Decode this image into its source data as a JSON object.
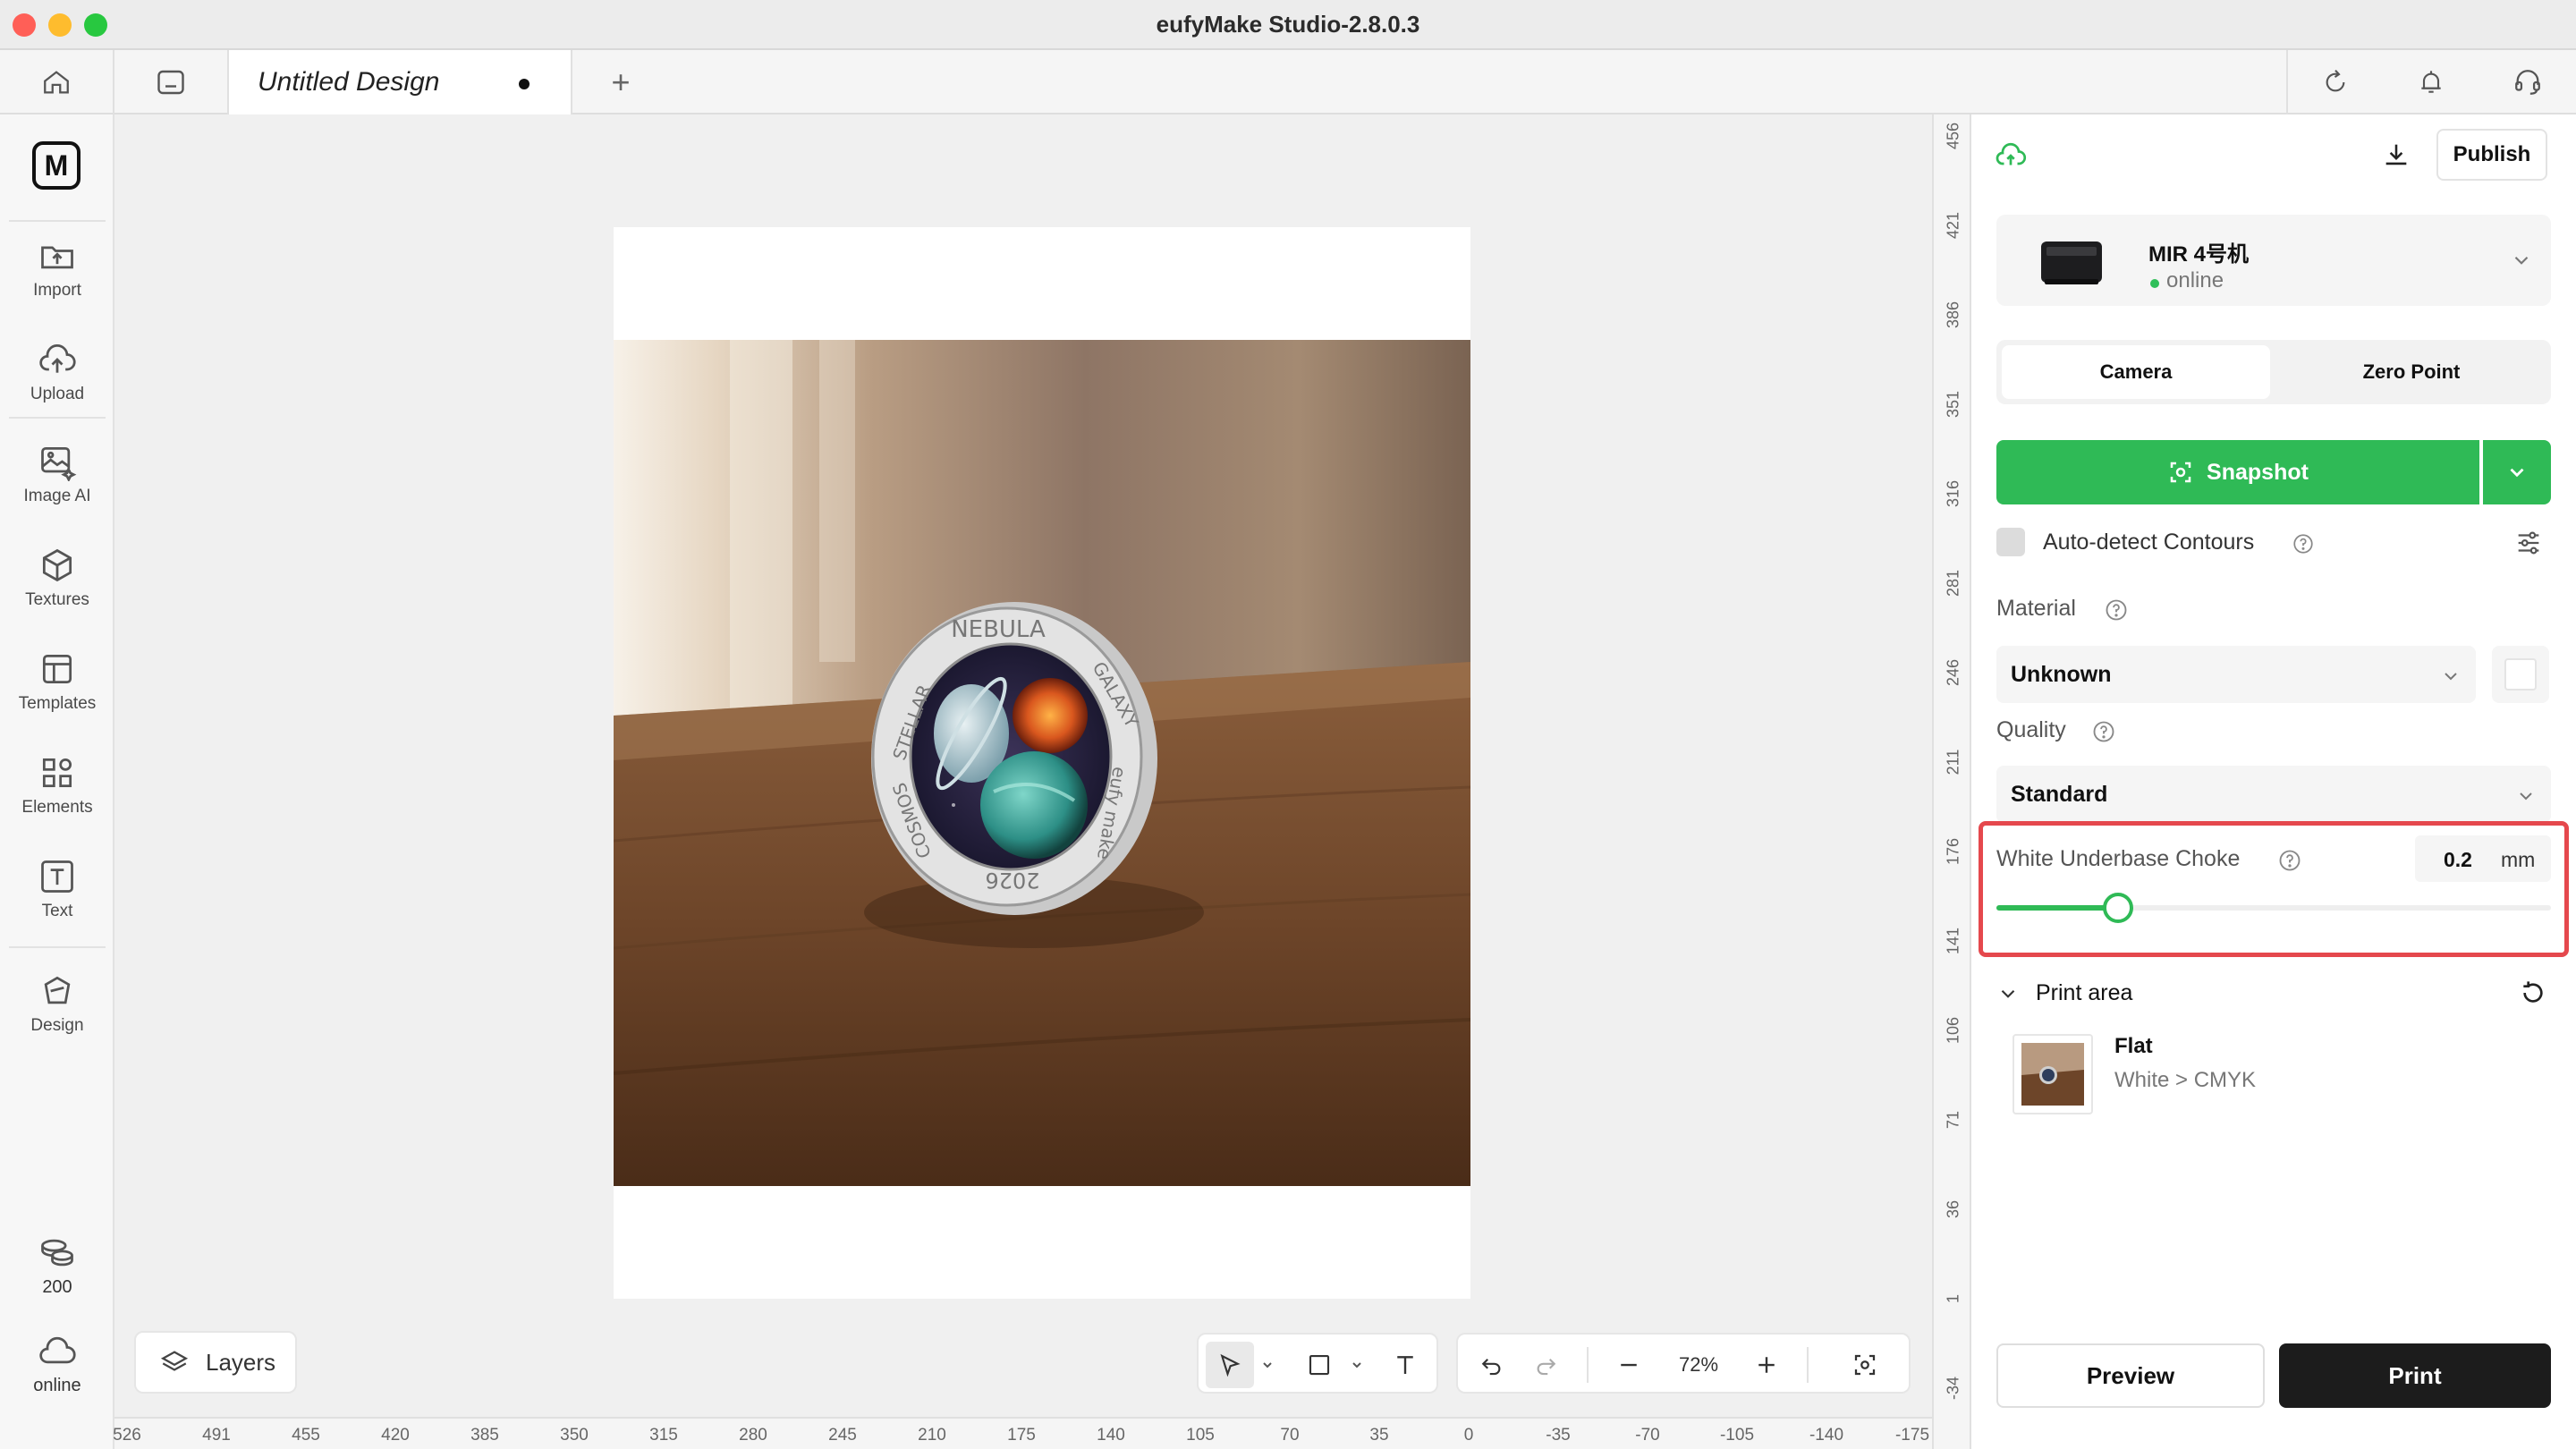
{
  "window": {
    "title": "eufyMake Studio-2.8.0.3"
  },
  "tabs": {
    "document_name": "Untitled Design",
    "add_tab_label": "+"
  },
  "sidebar": {
    "logo": "M",
    "items": [
      {
        "label": "Import",
        "icon": "import-icon"
      },
      {
        "label": "Upload",
        "icon": "upload-icon"
      },
      {
        "label": "Image AI",
        "icon": "image-ai-icon"
      },
      {
        "label": "Textures",
        "icon": "textures-icon"
      },
      {
        "label": "Templates",
        "icon": "templates-icon"
      },
      {
        "label": "Elements",
        "icon": "elements-icon"
      },
      {
        "label": "Text",
        "icon": "text-icon"
      },
      {
        "label": "Design",
        "icon": "design-icon"
      }
    ],
    "credits": "200",
    "status": "online"
  },
  "canvas": {
    "layers_label": "Layers",
    "zoom": "72%",
    "coin_text": {
      "top": "NEBULA",
      "left": "STELLAR",
      "right": "GALAXY",
      "lower_left": "COSMOS",
      "lower_right": "eufy make",
      "bottom": "2026"
    }
  },
  "rulers": {
    "horizontal": [
      "526",
      "491",
      "455",
      "420",
      "385",
      "350",
      "315",
      "280",
      "245",
      "210",
      "175",
      "140",
      "105",
      "70",
      "35",
      "0",
      "-35",
      "-70",
      "-105",
      "-140",
      "-175"
    ],
    "vertical": [
      "456",
      "421",
      "386",
      "351",
      "316",
      "281",
      "246",
      "211",
      "176",
      "141",
      "106",
      "71",
      "36",
      "1",
      "-34"
    ]
  },
  "panel": {
    "publish_label": "Publish",
    "device": {
      "name": "MIR 4号机",
      "status": "online"
    },
    "camera_tabs": [
      "Camera",
      "Zero Point"
    ],
    "snapshot_label": "Snapshot",
    "auto_detect_label": "Auto-detect Contours",
    "material": {
      "label": "Material",
      "value": "Unknown"
    },
    "quality": {
      "label": "Quality",
      "value": "Standard"
    },
    "choke": {
      "label": "White Underbase Choke",
      "value": "0.2",
      "unit": "mm",
      "slider_fraction": 0.22
    },
    "print_area": {
      "label": "Print area",
      "mode": "Flat",
      "color_order": "White > CMYK"
    },
    "preview_label": "Preview",
    "print_label": "Print"
  },
  "colors": {
    "accent_green": "#2fba56",
    "highlight_red": "#e5484d",
    "print_button": "#1c1c1c"
  }
}
